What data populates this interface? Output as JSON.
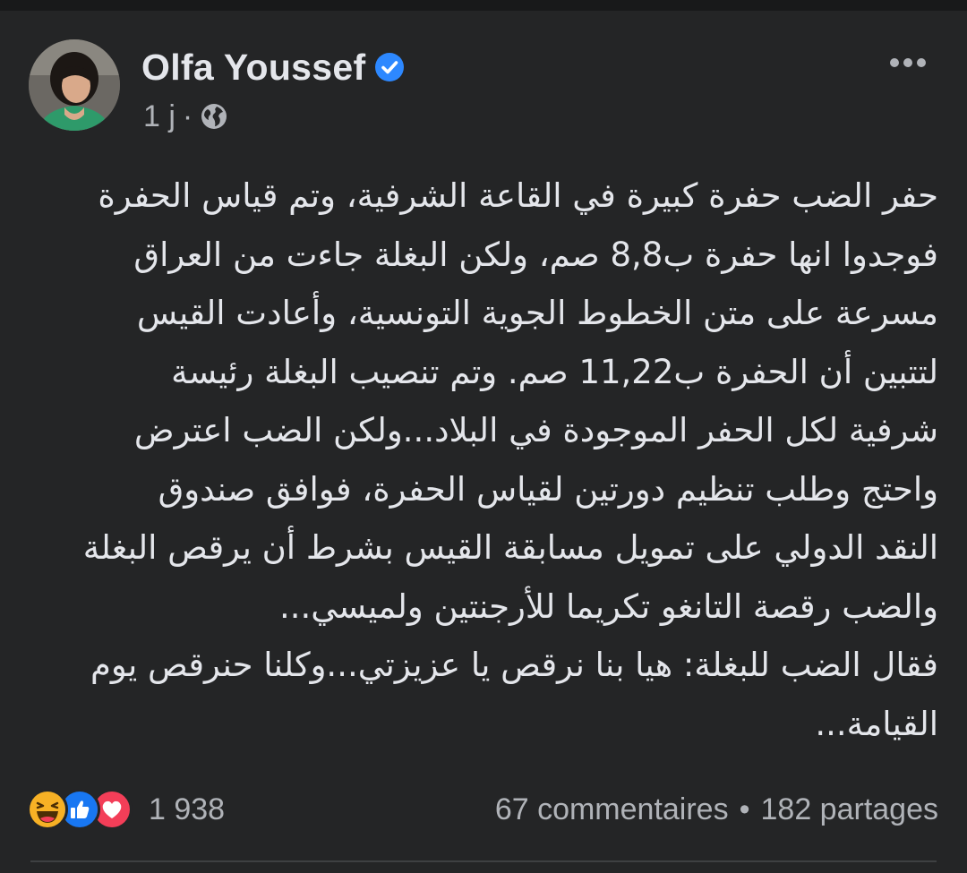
{
  "author": {
    "name": "Olfa Youssef",
    "verified": true
  },
  "meta": {
    "time": "1 j",
    "separator": "·",
    "audience_icon": "globe-icon"
  },
  "post": {
    "lines": [
      "حفر الضب حفرة كبيرة في القاعة الشرفية، وتم قياس الحفرة",
      "فوجدوا انها حفرة ب8,8 صم، ولكن البغلة جاءت من العراق",
      "مسرعة على متن الخطوط الجوية التونسية، وأعادت القيس",
      "لتتبين أن الحفرة ب11,22 صم. وتم تنصيب البغلة رئيسة",
      "شرفية لكل الحفر الموجودة في البلاد...ولكن الضب اعترض",
      "واحتج وطلب تنظيم دورتين لقياس الحفرة، فوافق  صندوق",
      "النقد الدولي على تمويل مسابقة القيس بشرط أن يرقص البغلة",
      "والضب رقصة التانغو تكريما للأرجنتين ولميسي...",
      "فقال الضب للبغلة: هيا بنا نرقص يا عزيزتي...وكلنا حنرقص يوم",
      "القيامة..."
    ]
  },
  "reactions": {
    "icons": [
      "haha-icon",
      "like-icon",
      "love-icon"
    ],
    "count": "1 938"
  },
  "stats": {
    "comments": "67 commentaires",
    "separator": "•",
    "shares": "182 partages"
  },
  "colors": {
    "background": "#242526",
    "text": "#e4e6eb",
    "secondary": "#b0b3b8",
    "verified": "#2d88ff",
    "like": "#1877f2",
    "love": "#f33e58",
    "haha": "#f7b125"
  }
}
